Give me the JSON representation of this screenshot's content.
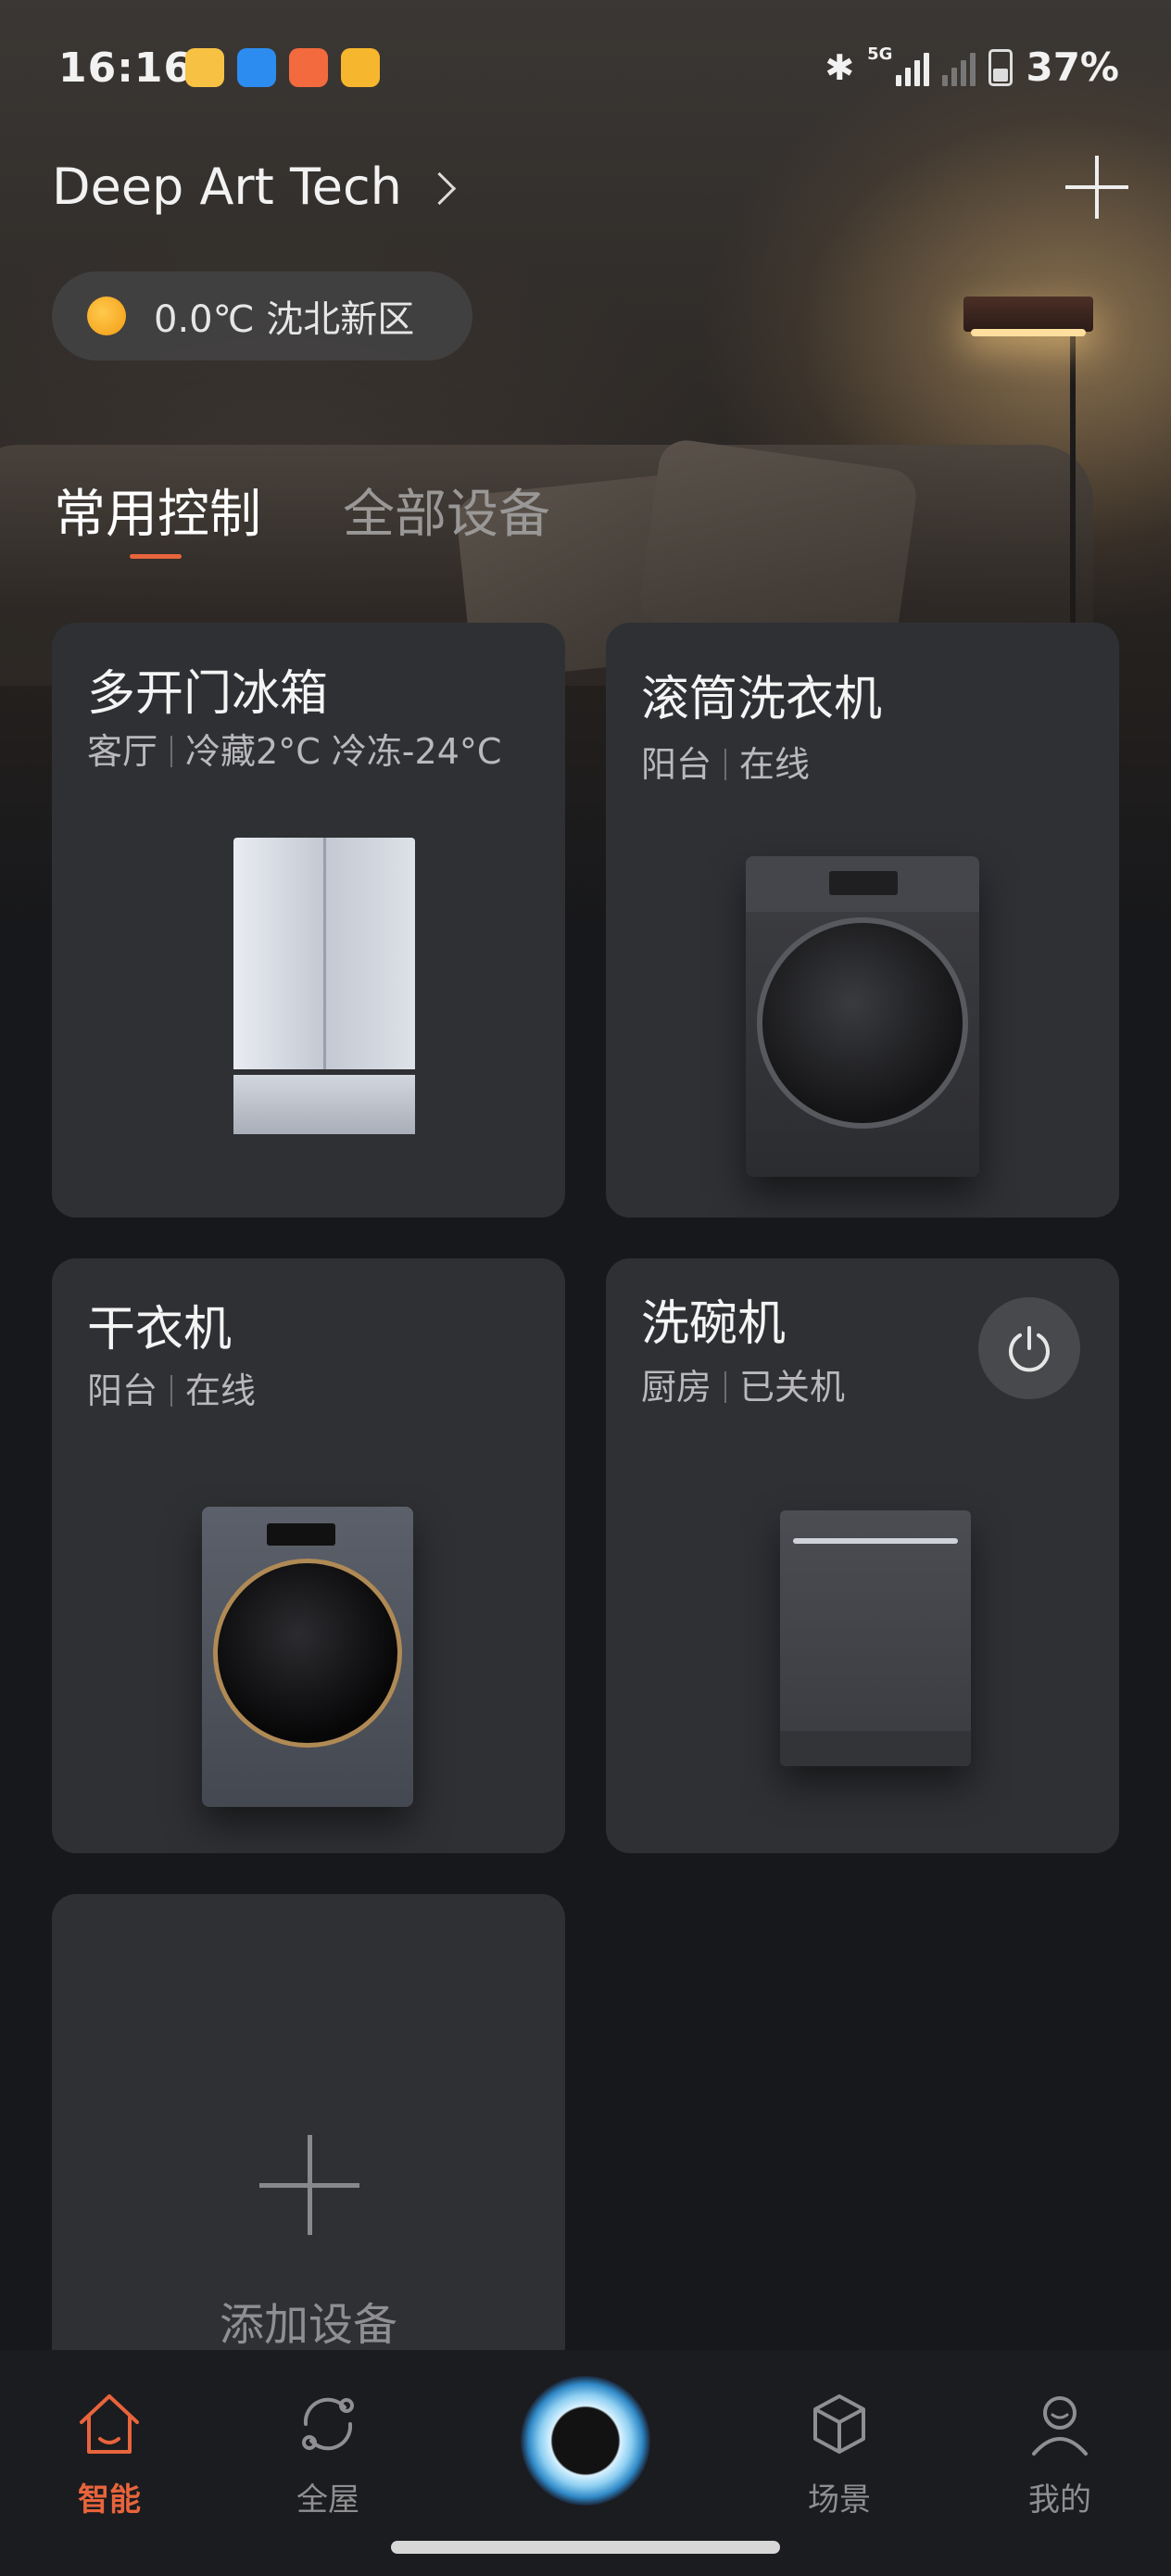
{
  "status_bar": {
    "time": "16:16",
    "app_icons": [
      {
        "name": "weibo-icon",
        "color": "#f7c144"
      },
      {
        "name": "browser-icon",
        "color": "#2d8cf0"
      },
      {
        "name": "mail-icon",
        "color": "#f26a3d"
      },
      {
        "name": "notes-icon",
        "color": "#f6b62d"
      }
    ],
    "network_label": "5G",
    "battery": "37%"
  },
  "header": {
    "home_name": "Deep Art Tech",
    "add_icon": "plus-icon"
  },
  "weather": {
    "text": "0.0℃ 沈北新区",
    "icon": "sun-icon"
  },
  "tabs": [
    {
      "label": "常用控制",
      "active": true
    },
    {
      "label": "全部设备",
      "active": false
    }
  ],
  "devices": [
    {
      "name": "多开门冰箱",
      "room": "客厅",
      "status": "冷藏2°C 冷冻-24°C",
      "image": "fridge"
    },
    {
      "name": "滚筒洗衣机",
      "room": "阳台",
      "status": "在线",
      "image": "washer"
    },
    {
      "name": "干衣机",
      "room": "阳台",
      "status": "在线",
      "image": "dryer"
    },
    {
      "name": "洗碗机",
      "room": "厨房",
      "status": "已关机",
      "image": "dishwasher",
      "power_button": true
    }
  ],
  "add_device": {
    "label": "添加设备"
  },
  "bottom_nav": [
    {
      "label": "智能",
      "icon": "home-icon",
      "active": true
    },
    {
      "label": "全屋",
      "icon": "sync-icon",
      "active": false
    },
    {
      "label": "",
      "icon": "voice-assistant-orb",
      "active": false
    },
    {
      "label": "场景",
      "icon": "cube-icon",
      "active": false
    },
    {
      "label": "我的",
      "icon": "user-icon",
      "active": false
    }
  ],
  "colors": {
    "accent": "#e8643c",
    "card": "#2f3034",
    "background": "#17181b"
  }
}
